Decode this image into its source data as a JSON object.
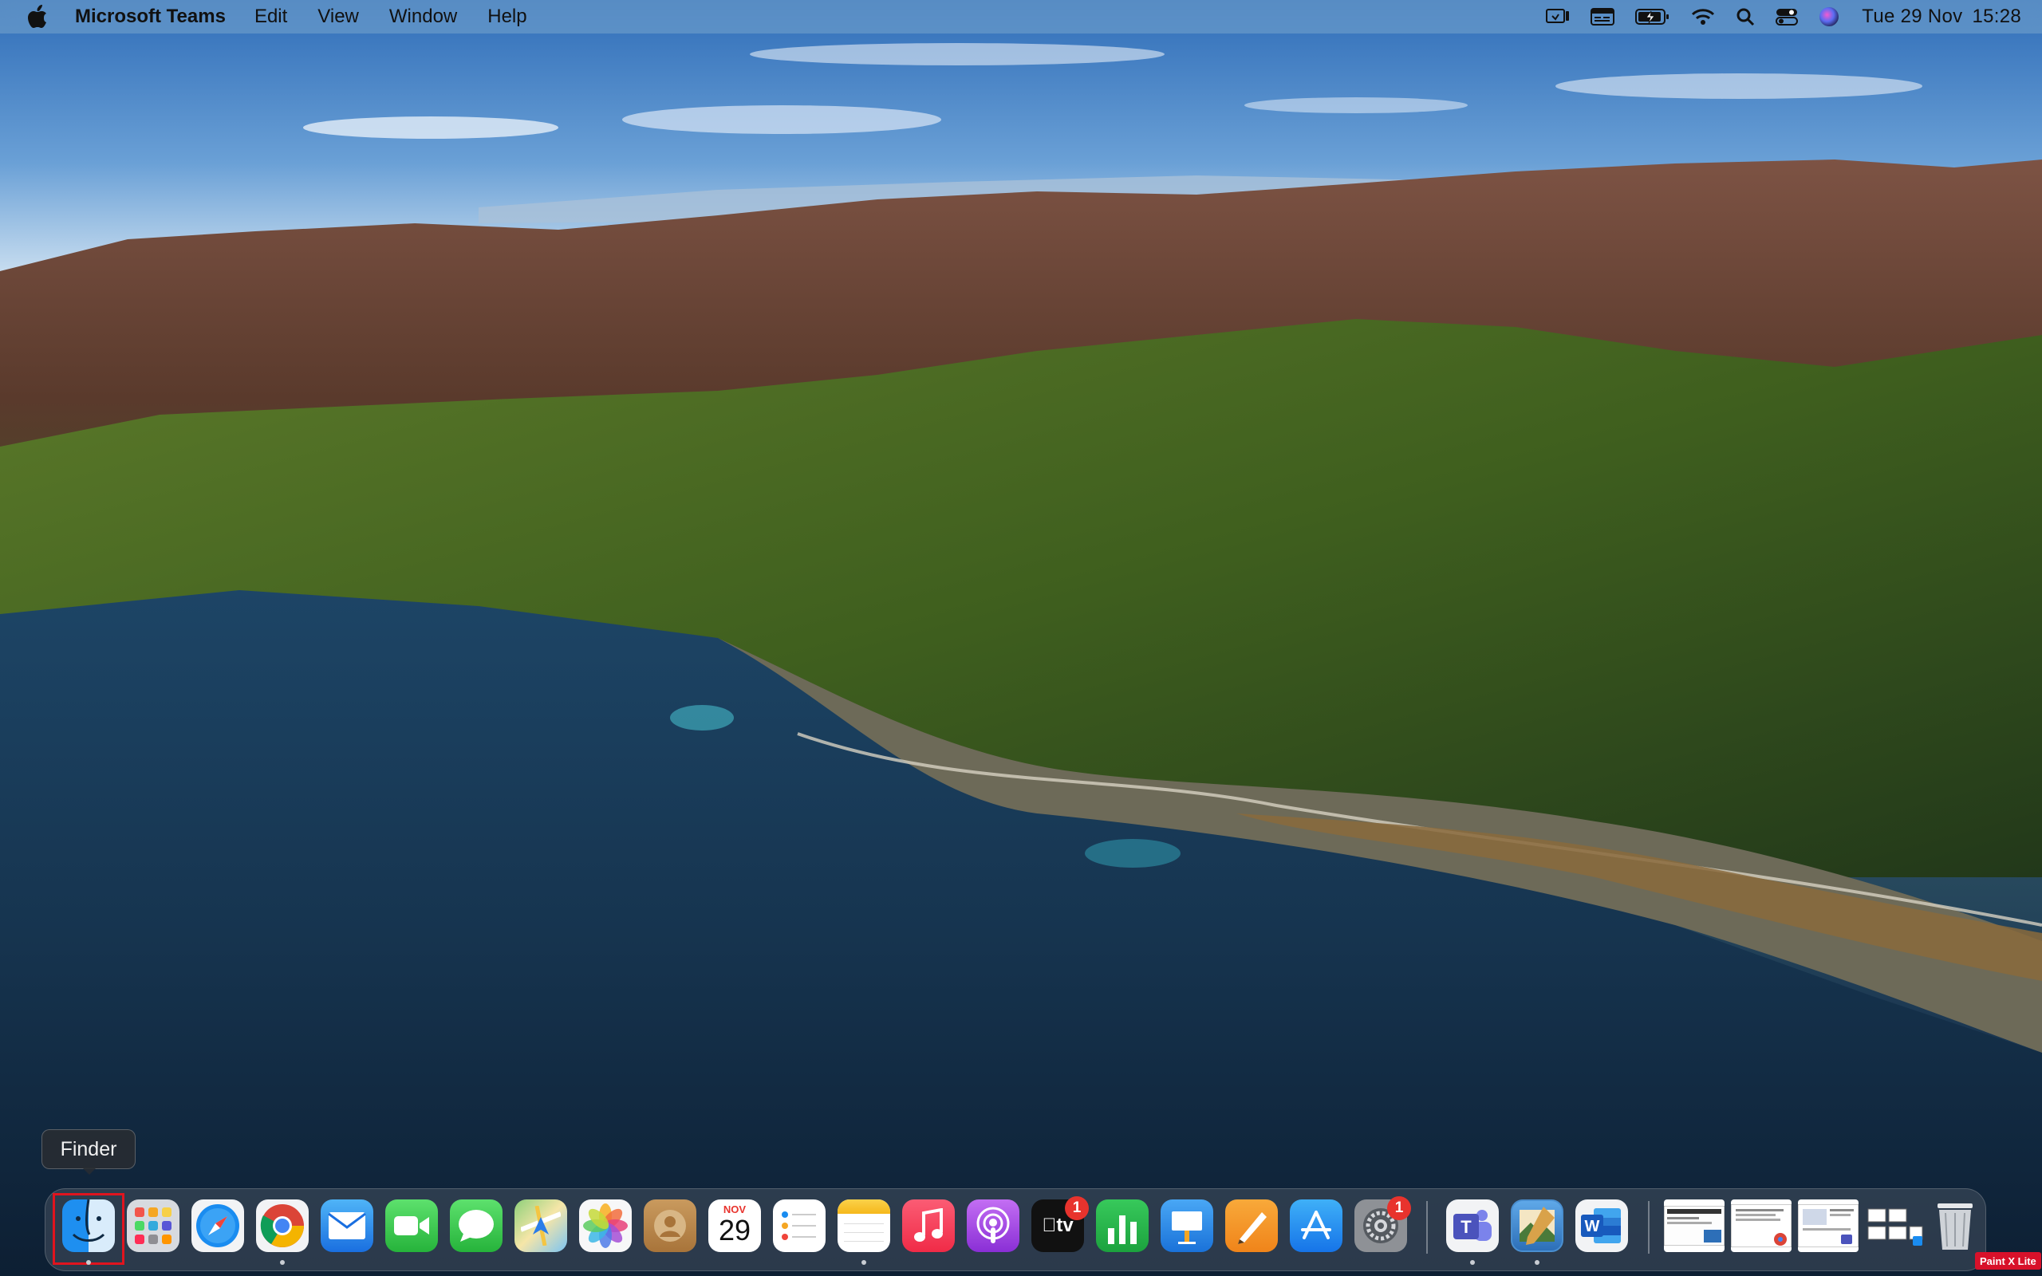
{
  "menubar": {
    "apple_icon": "apple-logo-icon",
    "app_name": "Microsoft Teams",
    "menus": [
      "Edit",
      "View",
      "Window",
      "Help"
    ],
    "status_icons": [
      "screen-mirroring-icon",
      "input-source-icon",
      "battery-charging-icon",
      "wifi-icon",
      "spotlight-search-icon",
      "control-center-icon",
      "siri-icon"
    ],
    "date": "Tue 29 Nov",
    "time": "15:28"
  },
  "tooltip": {
    "text": "Finder"
  },
  "dock": {
    "apps": [
      {
        "name": "Finder",
        "icon": "finder-icon",
        "running": true
      },
      {
        "name": "Launchpad",
        "icon": "launchpad-icon",
        "running": false
      },
      {
        "name": "Safari",
        "icon": "safari-icon",
        "running": false
      },
      {
        "name": "Google Chrome",
        "icon": "chrome-icon",
        "running": true
      },
      {
        "name": "Mail",
        "icon": "mail-icon",
        "running": false
      },
      {
        "name": "FaceTime",
        "icon": "facetime-icon",
        "running": false
      },
      {
        "name": "Messages",
        "icon": "messages-icon",
        "running": false
      },
      {
        "name": "Maps",
        "icon": "maps-icon",
        "running": false
      },
      {
        "name": "Photos",
        "icon": "photos-icon",
        "running": false
      },
      {
        "name": "Contacts",
        "icon": "contacts-icon",
        "running": false
      },
      {
        "name": "Calendar",
        "icon": "calendar-icon",
        "running": false,
        "month": "NOV",
        "day": "29"
      },
      {
        "name": "Reminders",
        "icon": "reminders-icon",
        "running": false
      },
      {
        "name": "Notes",
        "icon": "notes-icon",
        "running": true
      },
      {
        "name": "Music",
        "icon": "music-icon",
        "running": false
      },
      {
        "name": "Podcasts",
        "icon": "podcasts-icon",
        "running": false
      },
      {
        "name": "TV",
        "icon": "apple-tv-icon",
        "running": false,
        "label": "tv",
        "badge": "1"
      },
      {
        "name": "Numbers",
        "icon": "numbers-icon",
        "running": false
      },
      {
        "name": "Keynote",
        "icon": "keynote-icon",
        "running": false
      },
      {
        "name": "Pages",
        "icon": "pages-icon",
        "running": false
      },
      {
        "name": "App Store",
        "icon": "app-store-icon",
        "running": false
      },
      {
        "name": "System Preferences",
        "icon": "system-preferences-icon",
        "running": false,
        "badge": "1"
      },
      {
        "name": "Microsoft Teams",
        "icon": "teams-icon",
        "running": true,
        "letter": "T"
      },
      {
        "name": "Preview",
        "icon": "preview-icon",
        "running": true
      },
      {
        "name": "Microsoft Word",
        "icon": "word-icon",
        "running": false,
        "letter": "W"
      }
    ],
    "recent_items": [
      "recent-window-thumbnail-icon",
      "recent-chrome-document-icon",
      "recent-teams-document-icon",
      "recent-screenshot-folder-icon"
    ],
    "trash": "trash-icon"
  },
  "watermark": {
    "text": "Paint X Lite"
  }
}
